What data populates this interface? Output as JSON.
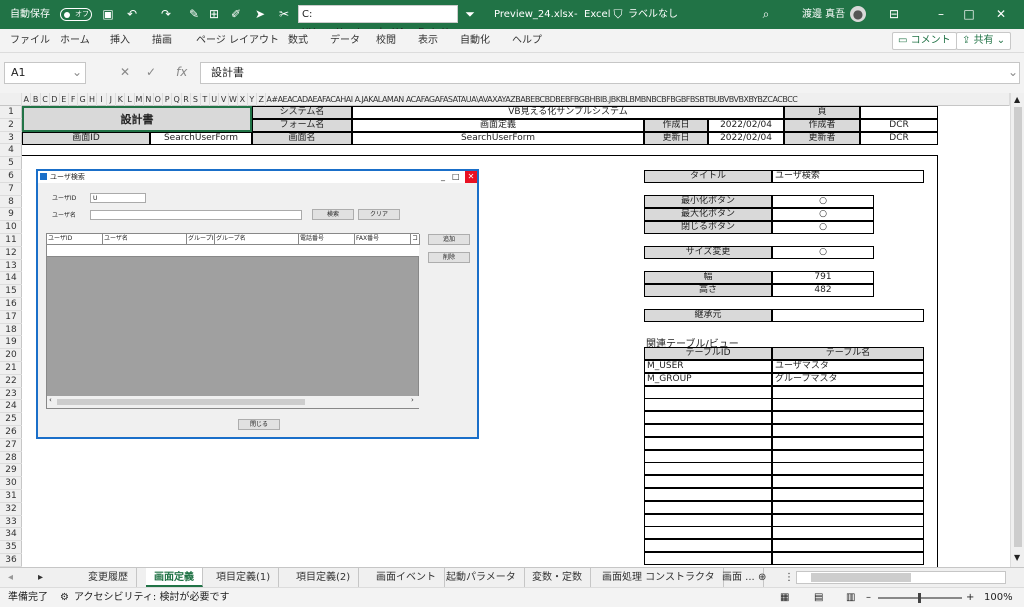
{
  "titlebar": {
    "autosave_label": "自動保存",
    "autosave_state": "オフ",
    "path": "C:¥Users¥watanabe¥AppData¥",
    "filename": "Preview_24.xlsx",
    "app_sep": "-",
    "app": "Excel",
    "label_status": "ラベルなし",
    "user": "渡邊 真吾"
  },
  "ribbon": {
    "tabs": [
      "ファイル",
      "ホーム",
      "挿入",
      "描画",
      "ページ レイアウト",
      "数式",
      "データ",
      "校閲",
      "表示",
      "自動化",
      "ヘルプ"
    ],
    "comment": "コメント",
    "share": "共有"
  },
  "formula": {
    "namebox": "A1",
    "value": "設計書"
  },
  "colheaders": [
    "A",
    "B",
    "C",
    "D",
    "E",
    "F",
    "G",
    "H",
    "I",
    "J",
    "K",
    "L",
    "M",
    "N",
    "O",
    "P",
    "Q",
    "R",
    "S",
    "T",
    "U",
    "V",
    "W",
    "X",
    "Y",
    "Z",
    "A#AEACADAEAFACAHAI A.JAKALAMAN ACAFAGAFASATAUA\\AVAXAYAZBABEBCBDBEBFBGBHBIB.JBKBLBMBNBCBFBGBFBSBTBUBVBVBXBYBZCACBCC"
  ],
  "rows": [
    "1",
    "2",
    "3",
    "4",
    "5",
    "6",
    "7",
    "8",
    "9",
    "10",
    "11",
    "12",
    "13",
    "14",
    "15",
    "16",
    "17",
    "18",
    "19",
    "20",
    "21",
    "22",
    "23",
    "24",
    "25",
    "26",
    "27",
    "28",
    "29",
    "30",
    "31",
    "32",
    "33",
    "34",
    "35",
    "36"
  ],
  "header_block": {
    "title": "設計書",
    "system_name_label": "システム名",
    "system_name": "VB見える化サンプルシステム",
    "page_label": "頁",
    "form_name_label": "フォーム名",
    "form_name": "画面定義",
    "created_date_label": "作成日",
    "created_date": "2022/02/04",
    "author_label": "作成者",
    "author": "DCR",
    "screen_id_label": "画面ID",
    "screen_id": "SearchUserForm",
    "screen_name_label": "画面名",
    "screen_name": "SearchUserForm",
    "updated_date_label": "更新日",
    "updated_date": "2022/02/04",
    "updater_label": "更新者",
    "updater": "DCR"
  },
  "dialog": {
    "title": "ユーザ検索",
    "userid_label": "ユーザID",
    "userid_value": "U",
    "username_label": "ユーザ名",
    "search_btn": "検索",
    "clear_btn": "クリア",
    "columns": [
      "ユーザID",
      "ユーザ名",
      "グループID",
      "グループ名",
      "電話番号",
      "FAX番号",
      "コ"
    ],
    "add_btn": "追加",
    "delete_btn": "削除",
    "close_btn": "閉じる"
  },
  "properties": {
    "title_label": "タイトル",
    "title_value": "ユーザ検索",
    "minimize_label": "最小化ボタン",
    "maximize_label": "最大化ボタン",
    "close_label": "閉じるボタン",
    "resize_label": "サイズ変更",
    "circle": "○",
    "width_label": "幅",
    "width_value": "791",
    "height_label": "高さ",
    "height_value": "482",
    "inherit_label": "継承元",
    "related_label": "関連テーブル/ビュー",
    "table_id_header": "テーブルID",
    "table_name_header": "テーブル名",
    "tables": [
      {
        "id": "M_USER",
        "name": "ユーザマスタ"
      },
      {
        "id": "M_GROUP",
        "name": "グループマスタ"
      }
    ]
  },
  "sheet_tabs": [
    "変更履歴",
    "画面定義",
    "項目定義(1)",
    "項目定義(2)",
    "画面イベント",
    "起動パラメータ",
    "変数・定数",
    "画面処理 コンストラクタ",
    "画面 ..."
  ],
  "status": {
    "ready": "準備完了",
    "accessibility": "アクセシビリティ: 検討が必要です",
    "zoom": "100%"
  }
}
